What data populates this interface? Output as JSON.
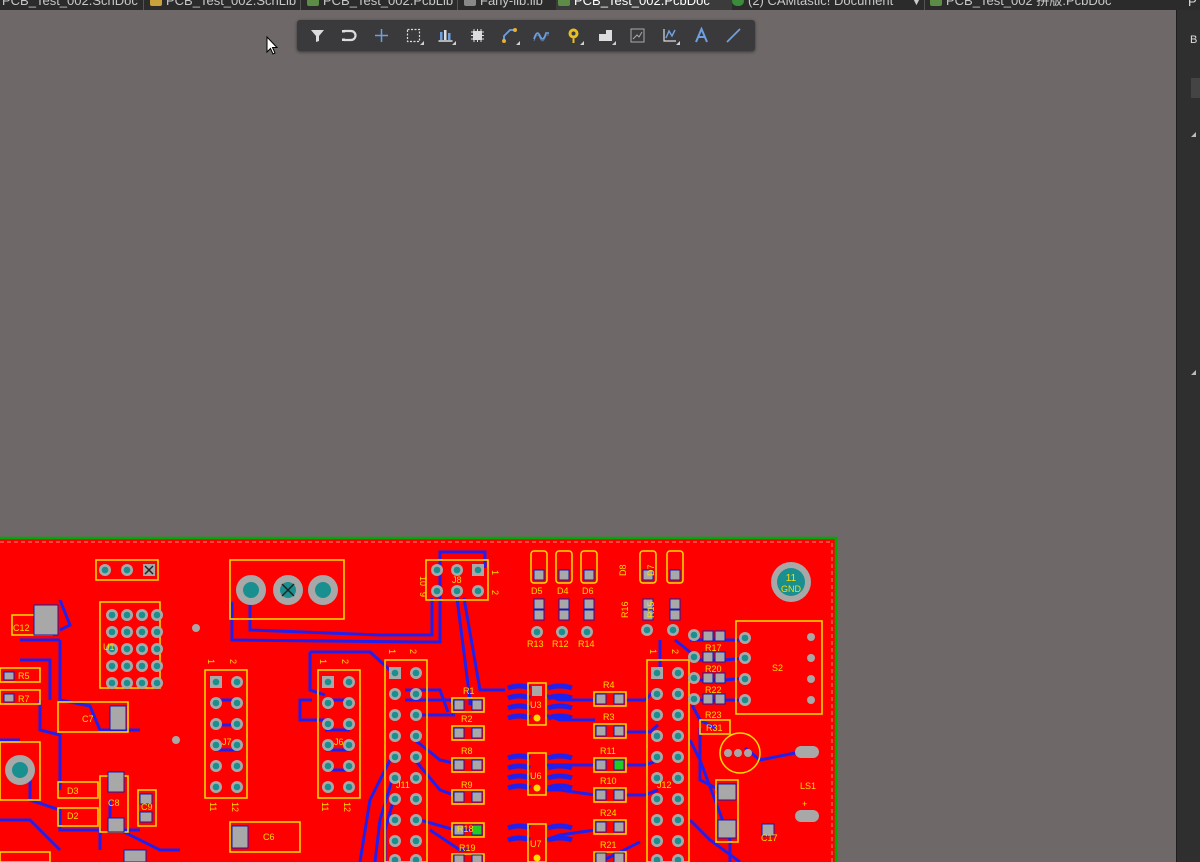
{
  "tabs": [
    {
      "label": "PCB_Test_002.SchDoc",
      "icon": "schematic-icon",
      "active": false
    },
    {
      "label": "PCB_Test_002.SchLib",
      "icon": "schlib-icon",
      "active": false
    },
    {
      "label": "PCB_Test_002.PcbLib",
      "icon": "pcblib-icon",
      "active": false
    },
    {
      "label": "Fany-lib.lib",
      "icon": "lib-icon",
      "active": false
    },
    {
      "label": "PCB_Test_002.PcbDoc",
      "icon": "pcbdoc-icon",
      "active": true
    },
    {
      "label": "(2) CAMtastic! Document",
      "icon": "cam-icon",
      "active": false
    },
    {
      "label": "PCB_Test_002 拼版.PcbDoc",
      "icon": "pcbdoc-icon",
      "active": false
    }
  ],
  "right_panel": {
    "top_label": "P",
    "label": "B"
  },
  "toolbar": {
    "buttons": [
      {
        "icon": "filter-icon",
        "name": "filter"
      },
      {
        "icon": "snap-magnet-icon",
        "name": "snap"
      },
      {
        "icon": "crosshair-plus-icon",
        "name": "place-point"
      },
      {
        "icon": "select-rect-icon",
        "name": "select-area"
      },
      {
        "icon": "align-icon",
        "name": "align"
      },
      {
        "icon": "component-chip-icon",
        "name": "place-component"
      },
      {
        "icon": "route-track-icon",
        "name": "interactive-route"
      },
      {
        "icon": "diff-pair-icon",
        "name": "diff-pair-route"
      },
      {
        "icon": "via-pad-icon",
        "name": "place-pad"
      },
      {
        "icon": "polygon-pour-icon",
        "name": "polygon-pour"
      },
      {
        "icon": "rule-check-icon",
        "name": "drc"
      },
      {
        "icon": "dimension-icon",
        "name": "dimension"
      },
      {
        "icon": "text-string-icon",
        "name": "place-string"
      },
      {
        "icon": "line-icon",
        "name": "place-line"
      }
    ]
  },
  "pcb": {
    "colors": {
      "copper": "#ff0000",
      "track": "#2020ee",
      "silk": "#ffdd00",
      "pad": "#a8a8a8",
      "hole": "#1a8f8f",
      "board_edge": "#00aa00"
    },
    "labels": {
      "c12": "C12",
      "r5": "R5",
      "r7": "R7",
      "c7": "C7",
      "d3": "D3",
      "d2": "D2",
      "c8": "C8",
      "c9": "C9",
      "c6": "C6",
      "j8": "J8",
      "j8_10": "10",
      "j8_9": "9",
      "j8_1": "1",
      "j8_2": "2",
      "d5": "D5",
      "d4": "D4",
      "d6": "D6",
      "r13": "R13",
      "r12": "R12",
      "r14": "R14",
      "d8": "D8",
      "d7": "D7",
      "r16": "R16",
      "r15": "R15",
      "r1": "R1",
      "r2": "R2",
      "r8": "R8",
      "r9": "R9",
      "r18": "R18",
      "r19": "R19",
      "u3": "U3",
      "u6": "U6",
      "u7": "U7",
      "r4": "R4",
      "r3": "R3",
      "r11": "R11",
      "r10": "R10",
      "r24": "R24",
      "r21": "R21",
      "r17": "R17",
      "r20": "R20",
      "r22": "R22",
      "r23": "R23",
      "r31": "R31",
      "s2": "S2",
      "ls1": "LS1",
      "c17": "C17",
      "j7": "J7",
      "j6": "J6",
      "j11": "J11",
      "j12": "J12",
      "u1": "U1",
      "n1": "1",
      "n2": "2",
      "n11": "11",
      "n12": "12",
      "mh_num": "11",
      "mh_net": "GND",
      "plus": "+"
    }
  }
}
